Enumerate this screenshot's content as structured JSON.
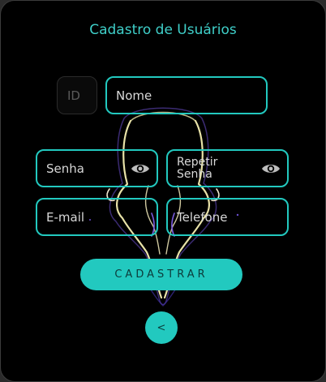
{
  "form": {
    "title": "Cadastro de Usuários",
    "id_placeholder": "ID",
    "name_placeholder": "Nome",
    "password_placeholder": "Senha",
    "repeat_password_line1": "Repetir",
    "repeat_password_line2": "Senha",
    "email_placeholder": "E-mail",
    "phone_placeholder": "Telefone",
    "submit_label": "CADASTRAR",
    "back_label": "<"
  },
  "colors": {
    "accent": "#22c9bf",
    "title": "#3fcfc9",
    "background": "#000000"
  },
  "icons": {
    "show_password": "eye-icon"
  }
}
